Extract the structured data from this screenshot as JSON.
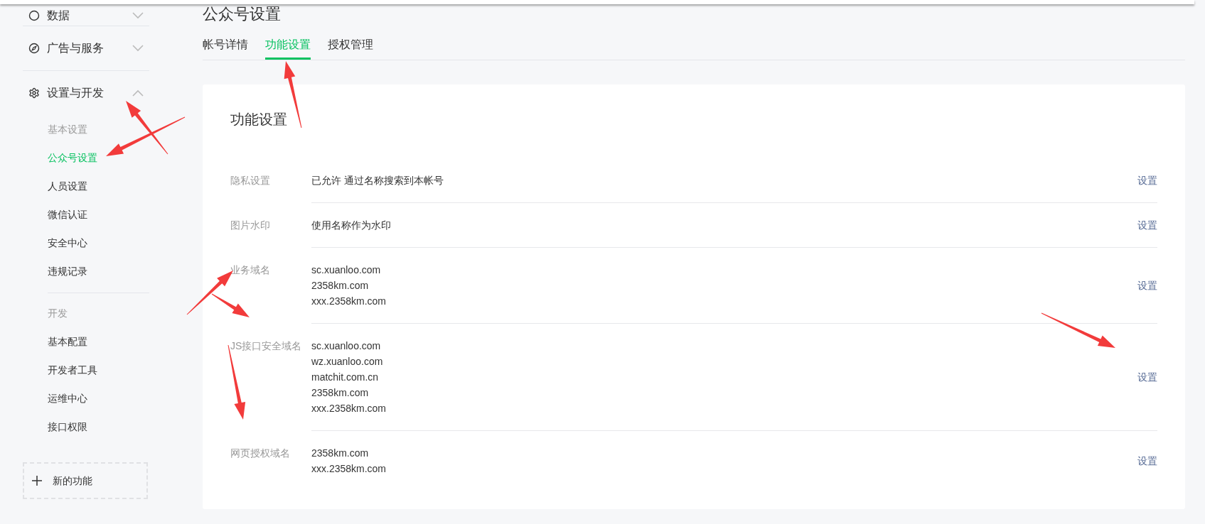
{
  "sidebar": {
    "sections": [
      {
        "label": "数据",
        "expanded": false
      },
      {
        "label": "广告与服务",
        "expanded": false
      },
      {
        "label": "设置与开发",
        "expanded": true,
        "groups": [
          {
            "title": "基本设置",
            "items": [
              {
                "label": "公众号设置",
                "selected": true
              },
              {
                "label": "人员设置",
                "selected": false
              },
              {
                "label": "微信认证",
                "selected": false
              },
              {
                "label": "安全中心",
                "selected": false
              },
              {
                "label": "违规记录",
                "selected": false
              }
            ]
          },
          {
            "title": "开发",
            "items": [
              {
                "label": "基本配置",
                "selected": false
              },
              {
                "label": "开发者工具",
                "selected": false
              },
              {
                "label": "运维中心",
                "selected": false
              },
              {
                "label": "接口权限",
                "selected": false
              }
            ]
          }
        ]
      }
    ],
    "add_button": "新的功能"
  },
  "page_title": "公众号设置",
  "tabs": [
    {
      "label": "帐号详情",
      "selected": false
    },
    {
      "label": "功能设置",
      "selected": true
    },
    {
      "label": "授权管理",
      "selected": false
    }
  ],
  "card": {
    "title": "功能设置",
    "rows": [
      {
        "label": "隐私设置",
        "values": [
          "已允许 通过名称搜索到本帐号"
        ],
        "action": "设置"
      },
      {
        "label": "图片水印",
        "values": [
          "使用名称作为水印"
        ],
        "action": "设置"
      },
      {
        "label": "业务域名",
        "values": [
          "sc.xuanloo.com",
          "2358km.com",
          "xxx.2358km.com"
        ],
        "action": "设置"
      },
      {
        "label": "JS接口安全域名",
        "values": [
          "sc.xuanloo.com",
          "wz.xuanloo.com",
          "matchit.com.cn",
          "2358km.com",
          "xxx.2358km.com"
        ],
        "action": "设置"
      },
      {
        "label": "网页授权域名",
        "values": [
          "2358km.com",
          "xxx.2358km.com"
        ],
        "action": "设置"
      }
    ]
  }
}
